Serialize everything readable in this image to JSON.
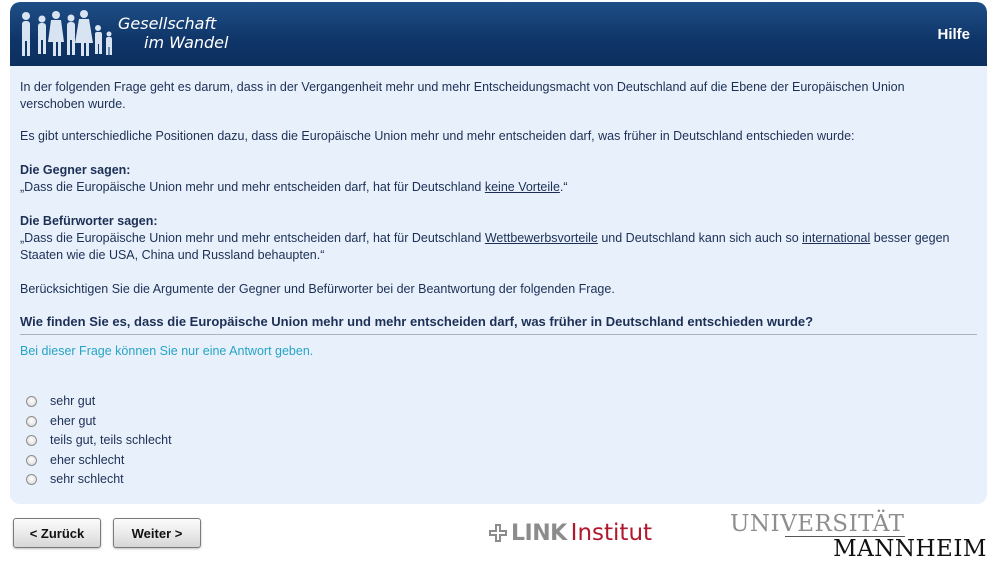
{
  "header": {
    "logo_line1": "Gesellschaft",
    "logo_line2": "im Wandel",
    "help_label": "Hilfe"
  },
  "content": {
    "intro": "In der folgenden Frage geht es darum, dass in der Vergangenheit mehr und mehr Entscheidungsmacht von Deutschland auf die Ebene der Europäischen Union verschoben wurde.",
    "positions": "Es gibt unterschiedliche Positionen dazu, dass die Europäische Union mehr und mehr entscheiden darf, was früher in Deutschland entschieden wurde:",
    "opponents_heading": "Die Gegner sagen:",
    "opponents_text_start": "„Dass die Europäische Union mehr und mehr entscheiden darf, hat für Deutschland ",
    "opponents_link": "keine Vorteile",
    "opponents_text_end": ".“",
    "supporters_heading": "Die Befürworter sagen:",
    "supporters_text_1": "„Dass die Europäische Union mehr und mehr entscheiden darf, hat für Deutschland ",
    "supporters_link1": "Wettbewerbsvorteile",
    "supporters_text_2": " und Deutschland kann sich auch so ",
    "supporters_link2": "international",
    "supporters_text_3": " besser gegen Staaten wie die USA, China und Russland behaupten.“",
    "consider": "Berücksichtigen Sie die Argumente der Gegner und Befürworter bei der Beantwortung der folgenden Frage.",
    "question": "Wie finden Sie es, dass die Europäische Union mehr und mehr entscheiden darf, was früher in Deutschland entschieden wurde?",
    "hint": "Bei dieser Frage können Sie nur eine Antwort geben."
  },
  "options": [
    "sehr gut",
    "eher gut",
    "teils gut, teils schlecht",
    "eher schlecht",
    "sehr schlecht"
  ],
  "nav": {
    "back_label": "< Zurück",
    "next_label": "Weiter >"
  },
  "logos": {
    "link_word": "LINK",
    "link_institut": "Institut",
    "uni_line1": "UNIVERSITÄT",
    "uni_line2": "MANNHEIM"
  },
  "colors": {
    "header_bg": "#0f3568",
    "panel_bg": "#e8f1fb",
    "text": "#1c2f55",
    "hint": "#27a3c6",
    "link_red": "#b0182e"
  }
}
